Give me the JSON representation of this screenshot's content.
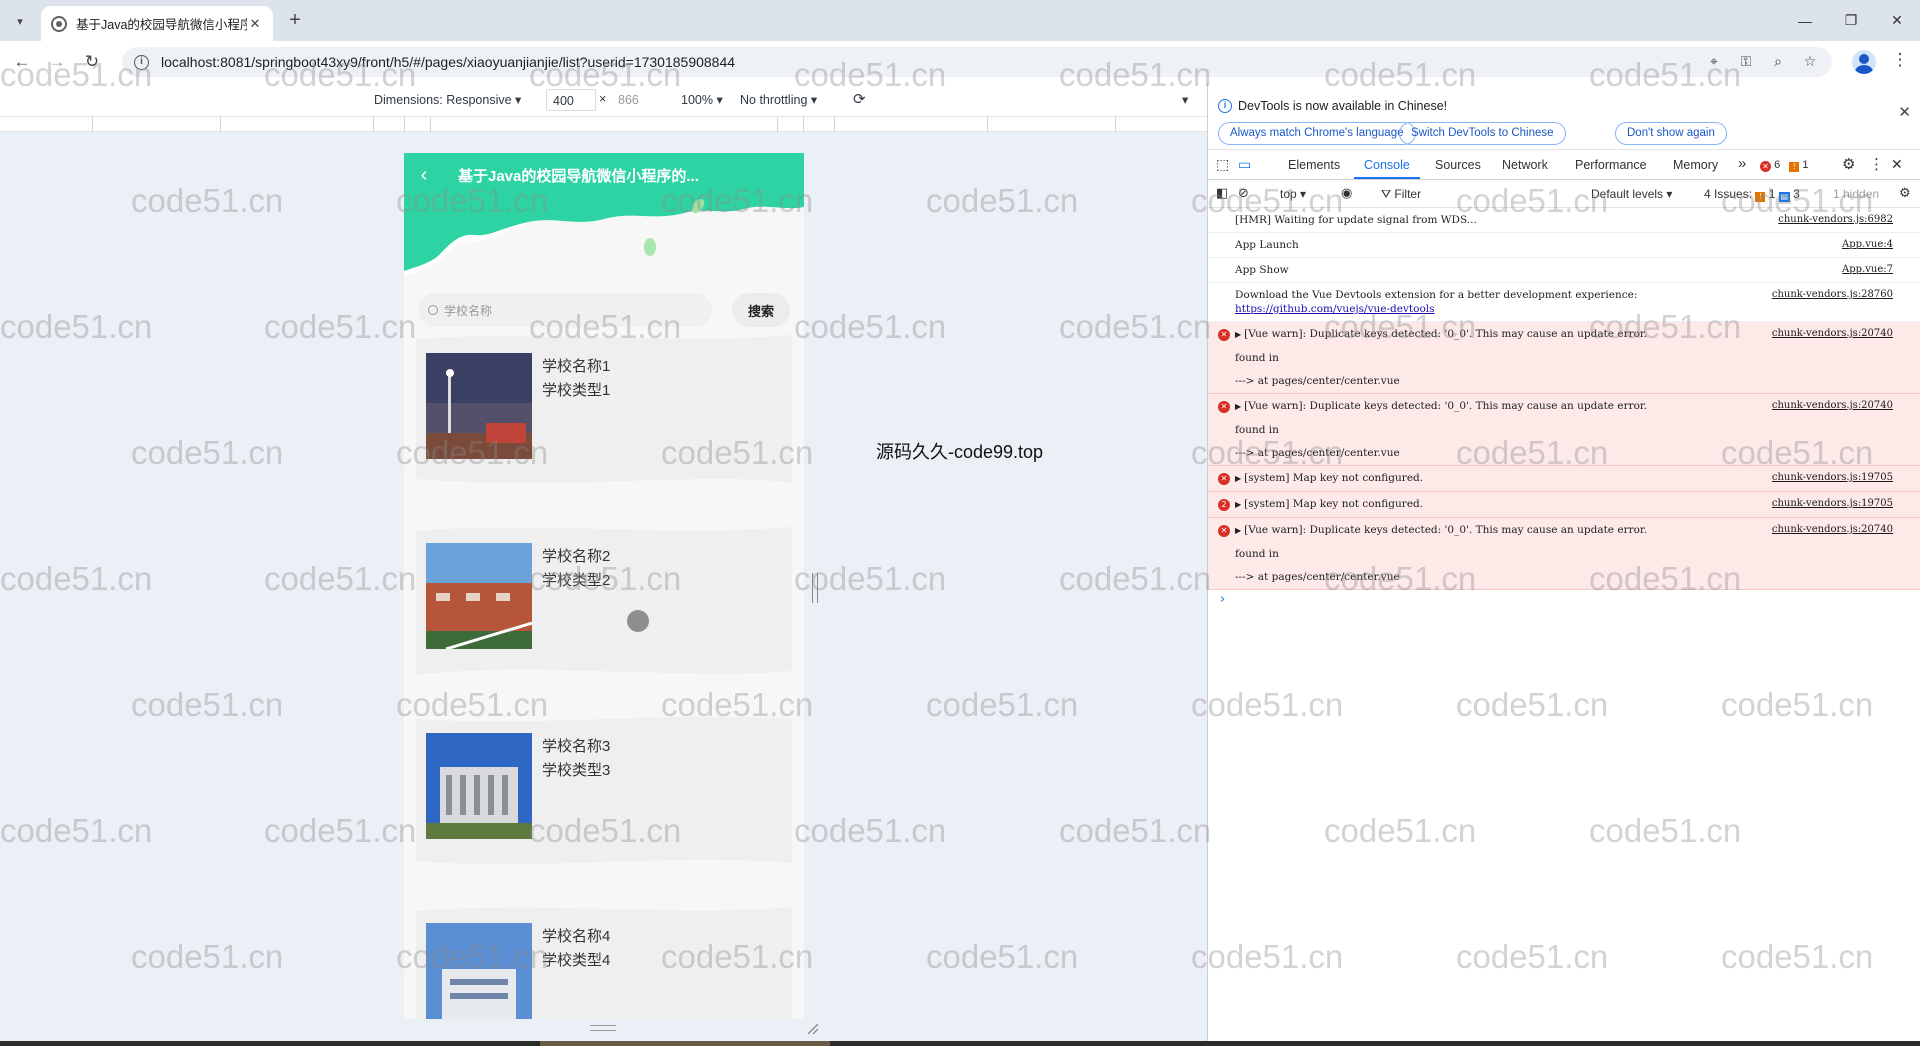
{
  "browser": {
    "tab_title": "基于Java的校园导航微信小程序",
    "tab_close": "✕",
    "new_tab": "+",
    "url": "localhost:8081/springboot43xy9/front/h5/#/pages/xiaoyuanjianjie/list?userid=1730185908844",
    "window_controls": {
      "minimize": "—",
      "restore": "❐",
      "close": "✕"
    }
  },
  "device_toolbar": {
    "dimensions_label": "Dimensions: Responsive ▾",
    "width": "400",
    "times": "×",
    "height": "866",
    "zoom": "100% ▾",
    "throttling": "No throttling ▾",
    "rotate_icon": "⟳",
    "more": "▾"
  },
  "phone": {
    "back": "‹",
    "header_title": "基于Java的校园导航微信小程序的...",
    "search_placeholder": "学校名称",
    "search_button": "搜索",
    "cards": [
      {
        "name": "学校名称1",
        "type": "学校类型1"
      },
      {
        "name": "学校名称2",
        "type": "学校类型2"
      },
      {
        "name": "学校名称3",
        "type": "学校类型3"
      },
      {
        "name": "学校名称4",
        "type": "学校类型4"
      }
    ]
  },
  "center_note": "源码久久-code99.top",
  "watermark_text": "code51.cn",
  "devtools": {
    "info_message": "DevTools is now available in Chinese!",
    "btn_match_language": "Always match Chrome's language",
    "btn_switch_chinese": "Switch DevTools to Chinese",
    "btn_dont_show": "Don't show again",
    "tabs": [
      "Elements",
      "Console",
      "Sources",
      "Network",
      "Performance",
      "Memory"
    ],
    "more_tabs": "»",
    "error_count": "6",
    "warning_count": "1",
    "context": "top ▾",
    "filter": "Filter",
    "levels": "Default levels ▾",
    "issues_label": "4 Issues:",
    "issues_warn": "1",
    "issues_info": "3",
    "hidden": "1 hidden",
    "logs": [
      {
        "text": "[HMR] Waiting for update signal from WDS...",
        "source": "chunk-vendors.js:6982",
        "level": "info"
      },
      {
        "text": "App Launch",
        "source": "App.vue:4",
        "level": "info"
      },
      {
        "text": "App Show",
        "source": "App.vue:7",
        "level": "info"
      },
      {
        "text": "Download the Vue Devtools extension for a better development experience:",
        "link": "https://github.com/vuejs/vue-devtools",
        "source": "chunk-vendors.js:28760",
        "level": "info"
      },
      {
        "text": "[Vue warn]: Duplicate keys detected: '0_0'. This may cause an update error.",
        "found": "found in",
        "trace": "---> at pages/center/center.vue",
        "source": "chunk-vendors.js:20740",
        "level": "error"
      },
      {
        "text": "[Vue warn]: Duplicate keys detected: '0_0'. This may cause an update error.",
        "found": "found in",
        "trace": "---> at pages/center/center.vue",
        "source": "chunk-vendors.js:20740",
        "level": "error"
      },
      {
        "text": "[system] Map key not configured.",
        "source": "chunk-vendors.js:19705",
        "level": "error"
      },
      {
        "text": "[system] Map key not configured.",
        "source": "chunk-vendors.js:19705",
        "level": "error",
        "count": "2"
      },
      {
        "text": "[Vue warn]: Duplicate keys detected: '0_0'. This may cause an update error.",
        "found": "found in",
        "trace": "---> at pages/center/center.vue",
        "source": "chunk-vendors.js:20740",
        "level": "error"
      }
    ],
    "prompt": "›"
  },
  "colors": {
    "phone_header": "#2ed3a3",
    "error_bg": "#fce9e8",
    "accent_blue": "#1a73e8"
  }
}
